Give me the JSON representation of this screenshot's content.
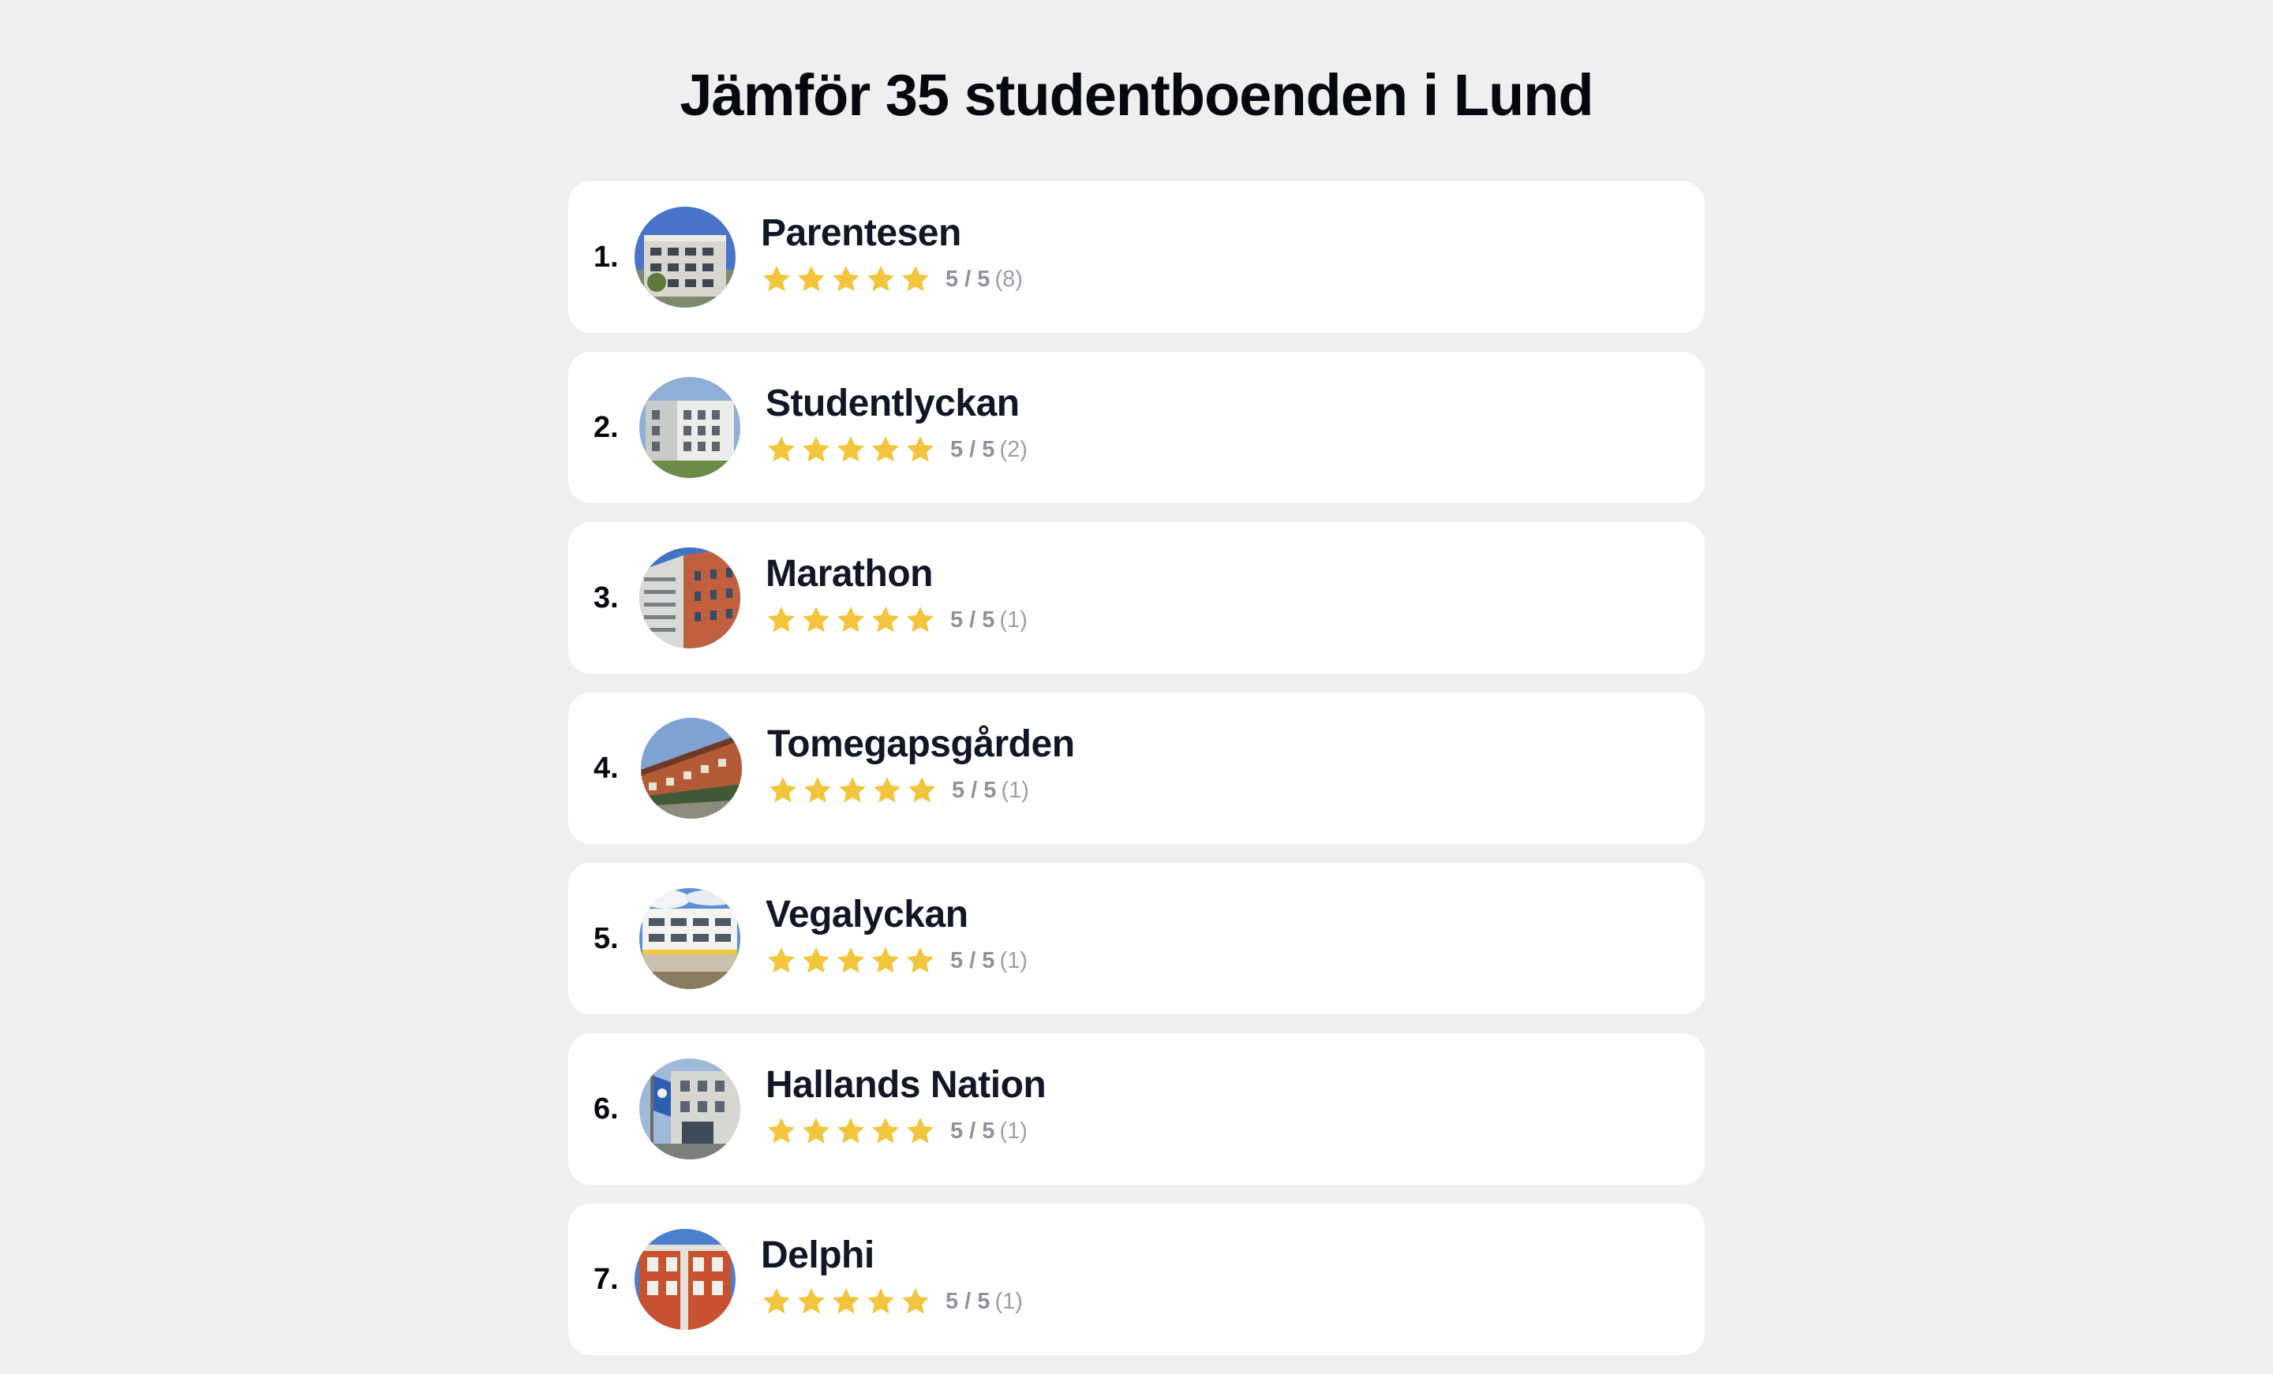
{
  "page": {
    "title": "Jämför 35 studentboenden i Lund"
  },
  "colors": {
    "background": "#efefef",
    "card": "#ffffff",
    "star": "#f2c53d",
    "muted_text": "#8e939c"
  },
  "residences": [
    {
      "rank": "1.",
      "name": "Parentesen",
      "rating": 5,
      "score": "5 / 5",
      "count": "(8)",
      "image_icon": "apartment-building-photo"
    },
    {
      "rank": "2.",
      "name": "Studentlyckan",
      "rating": 5,
      "score": "5 / 5",
      "count": "(2)",
      "image_icon": "apartment-building-photo"
    },
    {
      "rank": "3.",
      "name": "Marathon",
      "rating": 5,
      "score": "5 / 5",
      "count": "(1)",
      "image_icon": "apartment-building-photo"
    },
    {
      "rank": "4.",
      "name": "Tomegapsgården",
      "rating": 5,
      "score": "5 / 5",
      "count": "(1)",
      "image_icon": "apartment-building-photo"
    },
    {
      "rank": "5.",
      "name": "Vegalyckan",
      "rating": 5,
      "score": "5 / 5",
      "count": "(1)",
      "image_icon": "apartment-building-photo"
    },
    {
      "rank": "6.",
      "name": "Hallands Nation",
      "rating": 5,
      "score": "5 / 5",
      "count": "(1)",
      "image_icon": "apartment-building-photo"
    },
    {
      "rank": "7.",
      "name": "Delphi",
      "rating": 5,
      "score": "5 / 5",
      "count": "(1)",
      "image_icon": "apartment-building-photo"
    }
  ]
}
